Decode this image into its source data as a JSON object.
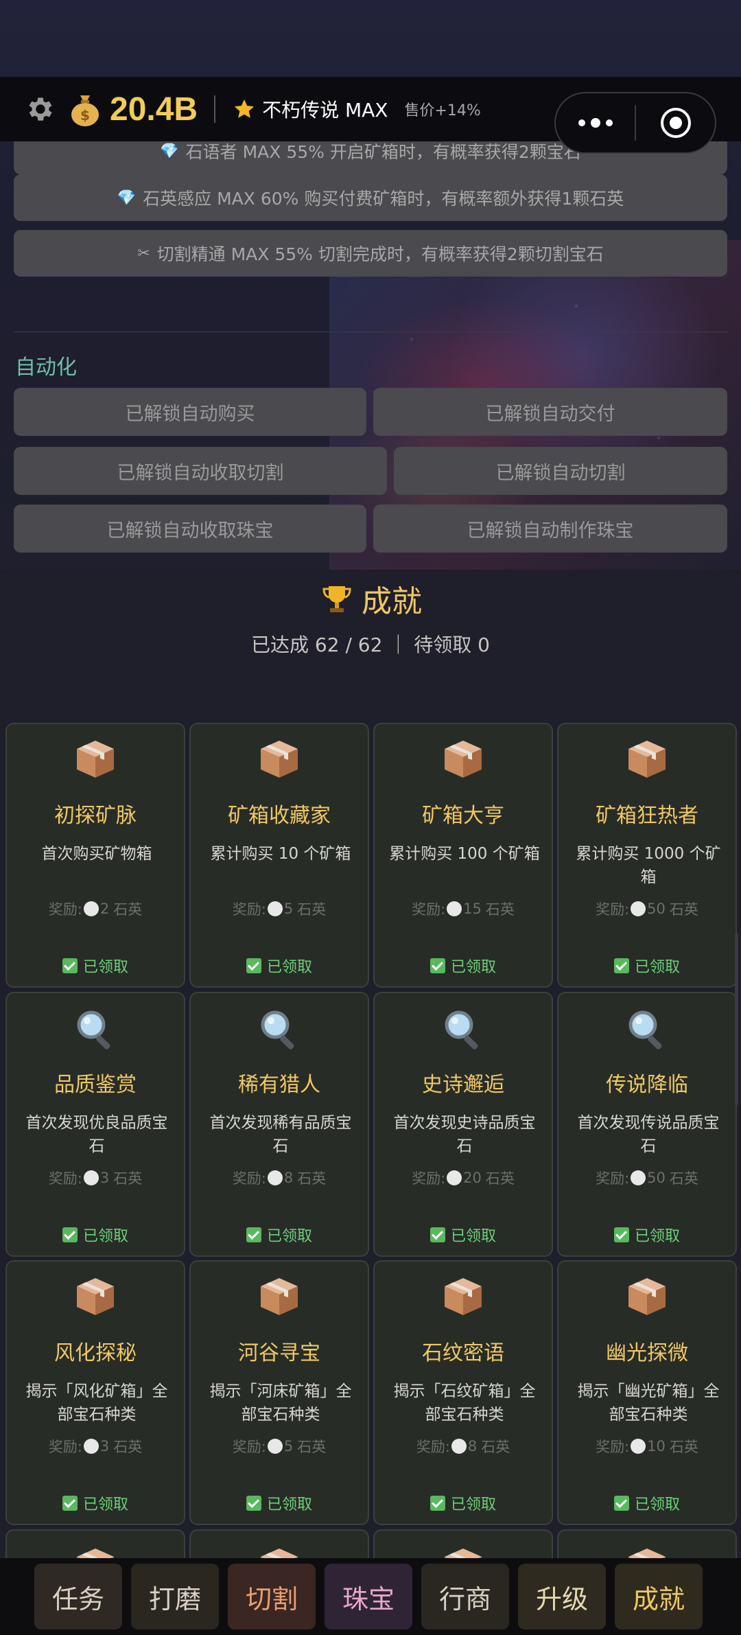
{
  "topbar": {
    "money": "20.4B",
    "rank": "不朽传说 MAX",
    "sell_bonus": "售价+14%"
  },
  "upgrades": [
    {
      "icon": "gem-icon",
      "text": "石语者 MAX 55% 开启矿箱时，有概率获得2颗宝石"
    },
    {
      "icon": "gem-icon",
      "text": "石英感应 MAX 60% 购买付费矿箱时，有概率额外获得1颗石英"
    },
    {
      "icon": "scissors-icon",
      "text": "切割精通 MAX 55% 切割完成时，有概率获得2颗切割宝石"
    }
  ],
  "automation": {
    "title": "自动化",
    "buttons": [
      "已解锁自动购买",
      "已解锁自动交付",
      "已解锁自动收取切割",
      "已解锁自动切割",
      "已解锁自动收取珠宝",
      "已解锁自动制作珠宝"
    ]
  },
  "achievements": {
    "title": "成就",
    "stats": "已达成 62 / 62 ｜ 待领取 0",
    "reward_label": "奖励:",
    "reward_unit": "石英",
    "status": "已领取",
    "cards": [
      {
        "icon": "box-icon",
        "name": "初探矿脉",
        "desc": "首次购买矿物箱",
        "reward": "2"
      },
      {
        "icon": "box-icon",
        "name": "矿箱收藏家",
        "desc": "累计购买 10 个矿箱",
        "reward": "5"
      },
      {
        "icon": "box-icon",
        "name": "矿箱大亨",
        "desc": "累计购买 100 个矿箱",
        "reward": "15"
      },
      {
        "icon": "box-icon",
        "name": "矿箱狂热者",
        "desc": "累计购买 1000 个矿箱",
        "reward": "50"
      },
      {
        "icon": "magnifier-icon",
        "name": "品质鉴赏",
        "desc": "首次发现优良品质宝石",
        "reward": "3"
      },
      {
        "icon": "magnifier-icon",
        "name": "稀有猎人",
        "desc": "首次发现稀有品质宝石",
        "reward": "8"
      },
      {
        "icon": "magnifier-icon",
        "name": "史诗邂逅",
        "desc": "首次发现史诗品质宝石",
        "reward": "20"
      },
      {
        "icon": "magnifier-icon",
        "name": "传说降临",
        "desc": "首次发现传说品质宝石",
        "reward": "50"
      },
      {
        "icon": "box-icon",
        "name": "风化探秘",
        "desc": "揭示「风化矿箱」全部宝石种类",
        "reward": "3"
      },
      {
        "icon": "box-icon",
        "name": "河谷寻宝",
        "desc": "揭示「河床矿箱」全部宝石种类",
        "reward": "5"
      },
      {
        "icon": "box-icon",
        "name": "石纹密语",
        "desc": "揭示「石纹矿箱」全部宝石种类",
        "reward": "8"
      },
      {
        "icon": "box-icon",
        "name": "幽光探微",
        "desc": "揭示「幽光矿箱」全部宝石种类",
        "reward": "10"
      }
    ]
  },
  "tabs": [
    {
      "label": "任务",
      "color": "#d9d2c4",
      "bg": "#2e2924"
    },
    {
      "label": "打磨",
      "color": "#d9d2c4",
      "bg": "#2a2620"
    },
    {
      "label": "切割",
      "color": "#e8a070",
      "bg": "#3a2622"
    },
    {
      "label": "珠宝",
      "color": "#e8a8c8",
      "bg": "#2e2435"
    },
    {
      "label": "行商",
      "color": "#d9d2c4",
      "bg": "#2a2622"
    },
    {
      "label": "升级",
      "color": "#e8d8b0",
      "bg": "#2e2a20"
    },
    {
      "label": "成就",
      "color": "#f0c864",
      "bg": "#2e2a1e"
    }
  ]
}
